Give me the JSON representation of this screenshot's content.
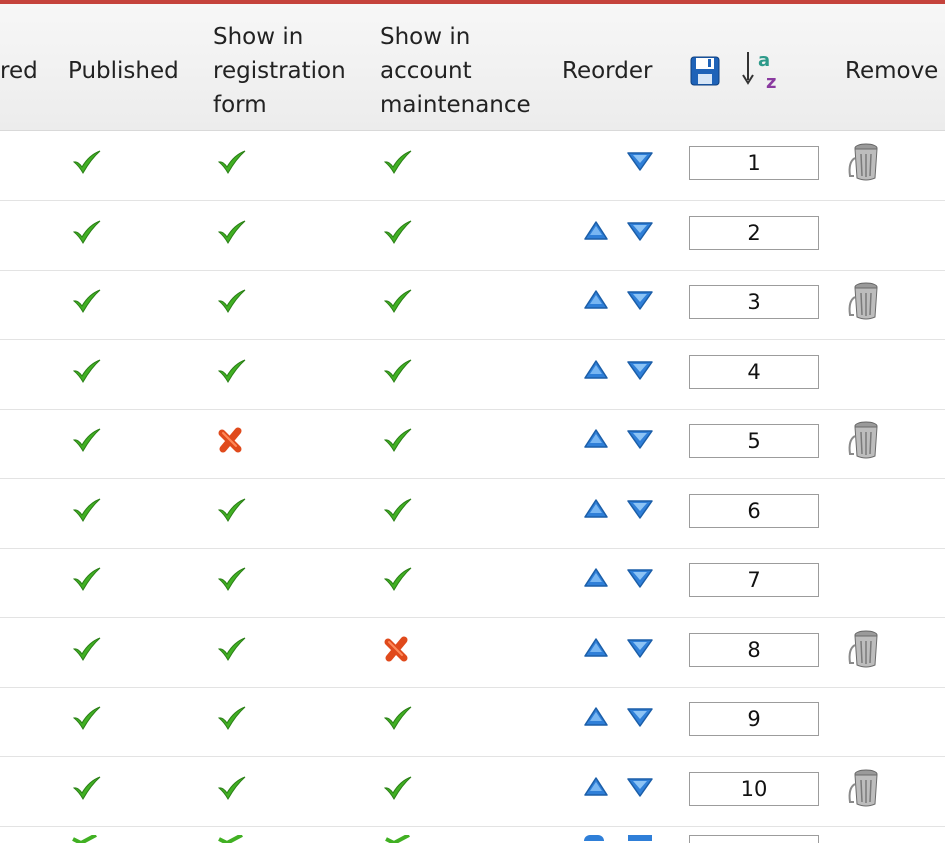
{
  "header": {
    "required_partial": "red",
    "published": "Published",
    "registration_l1": "Show in",
    "registration_l2": "registration",
    "registration_l3": "form",
    "account_l1": "Show in",
    "account_l2": "account",
    "account_l3": "maintenance",
    "reorder": "Reorder",
    "remove_partial": "Remove"
  },
  "icons": {
    "check": "check-icon",
    "cross": "cross-icon",
    "up": "arrow-up-icon",
    "down": "arrow-down-icon",
    "save": "save-icon",
    "sort": "sort-az-icon",
    "trash": "trash-icon"
  },
  "colors": {
    "accent": "#c5433c",
    "check_green": "#3fae1f",
    "cross_red": "#e04a1c",
    "arrow_blue": "#2f7fd8"
  },
  "rows": [
    {
      "order": "1",
      "published": true,
      "registration": true,
      "account": true,
      "up": false,
      "down": true,
      "remove": true
    },
    {
      "order": "2",
      "published": true,
      "registration": true,
      "account": true,
      "up": true,
      "down": true,
      "remove": false
    },
    {
      "order": "3",
      "published": true,
      "registration": true,
      "account": true,
      "up": true,
      "down": true,
      "remove": true
    },
    {
      "order": "4",
      "published": true,
      "registration": true,
      "account": true,
      "up": true,
      "down": true,
      "remove": false
    },
    {
      "order": "5",
      "published": true,
      "registration": false,
      "account": true,
      "up": true,
      "down": true,
      "remove": true
    },
    {
      "order": "6",
      "published": true,
      "registration": true,
      "account": true,
      "up": true,
      "down": true,
      "remove": false
    },
    {
      "order": "7",
      "published": true,
      "registration": true,
      "account": true,
      "up": true,
      "down": true,
      "remove": false
    },
    {
      "order": "8",
      "published": true,
      "registration": true,
      "account": false,
      "up": true,
      "down": true,
      "remove": true
    },
    {
      "order": "9",
      "published": true,
      "registration": true,
      "account": true,
      "up": true,
      "down": true,
      "remove": false
    },
    {
      "order": "10",
      "published": true,
      "registration": true,
      "account": true,
      "up": true,
      "down": true,
      "remove": true
    }
  ]
}
